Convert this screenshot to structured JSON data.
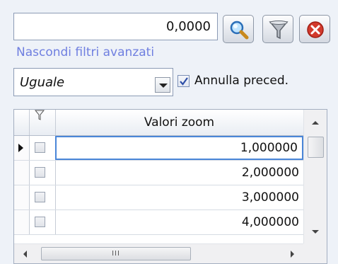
{
  "filter": {
    "value": "0,0000",
    "advanced_link": "Nascondi filtri avanzati",
    "operator": "Uguale",
    "cancel_previous_label": "Annulla preced.",
    "cancel_previous_checked": true
  },
  "toolbar": {
    "search_icon": "search-icon",
    "filter_icon": "funnel-icon",
    "close_icon": "close-icon"
  },
  "grid": {
    "column_header": "Valori zoom",
    "rows": [
      {
        "value": "1,000000",
        "checked": false,
        "current": true
      },
      {
        "value": "2,000000",
        "checked": false,
        "current": false
      },
      {
        "value": "3,000000",
        "checked": false,
        "current": false
      },
      {
        "value": "4,000000",
        "checked": false,
        "current": false
      }
    ],
    "hscroll_thumb_grip": "III"
  },
  "colors": {
    "link": "#6f7fe0",
    "active_border": "#4a86d8",
    "close_red": "#d33a2c"
  }
}
